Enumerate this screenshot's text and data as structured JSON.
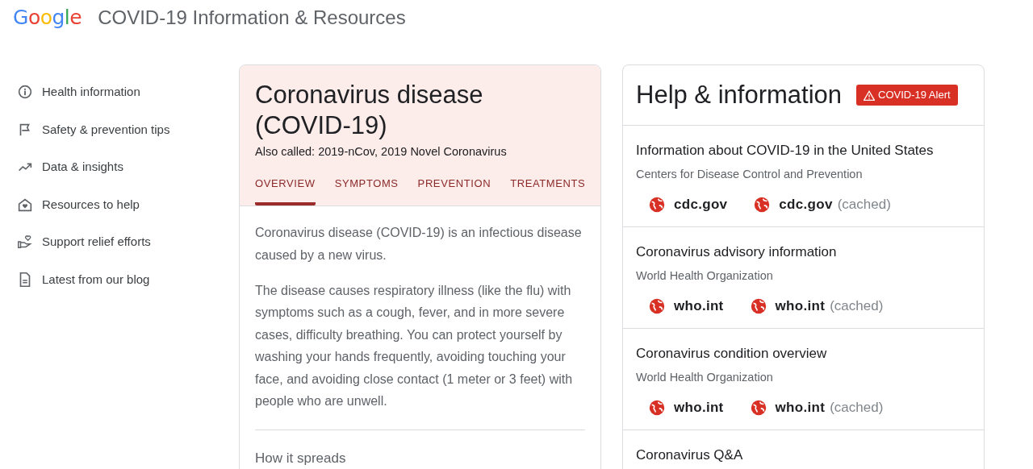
{
  "header": {
    "logo": "Google",
    "title": "COVID-19 Information & Resources"
  },
  "sidebar": {
    "items": [
      {
        "label": "Health information"
      },
      {
        "label": "Safety & prevention tips"
      },
      {
        "label": "Data & insights"
      },
      {
        "label": "Resources to help"
      },
      {
        "label": "Support relief efforts"
      },
      {
        "label": "Latest from our blog"
      }
    ]
  },
  "disease_card": {
    "title": "Coronavirus disease (COVID-19)",
    "also_called": "Also called: 2019-nCov, 2019 Novel Coronavirus",
    "tabs": [
      {
        "label": "OVERVIEW",
        "selected": true
      },
      {
        "label": "SYMPTOMS",
        "selected": false
      },
      {
        "label": "PREVENTION",
        "selected": false
      },
      {
        "label": "TREATMENTS",
        "selected": false
      }
    ],
    "paragraphs": [
      "Coronavirus disease (COVID-19) is an infectious disease caused by a new virus.",
      "The disease causes respiratory illness (like the flu) with symptoms such as a cough, fever, and in more severe cases, difficulty breathing. You can protect yourself by washing your hands frequently, avoiding touching your face, and avoiding close contact (1 meter or 3 feet) with people who are unwell."
    ],
    "section_heading": "How it spreads"
  },
  "help_card": {
    "title": "Help & information",
    "alert": "COVID-19 Alert",
    "sections": [
      {
        "title": "Information about COVID-19 in the United States",
        "source": "Centers for Disease Control and Prevention",
        "links": [
          {
            "domain": "cdc.gov"
          },
          {
            "domain": "cdc.gov",
            "note": "(cached)"
          }
        ]
      },
      {
        "title": "Coronavirus advisory information",
        "source": "World Health Organization",
        "links": [
          {
            "domain": "who.int"
          },
          {
            "domain": "who.int",
            "note": "(cached)"
          }
        ]
      },
      {
        "title": "Coronavirus condition overview",
        "source": "World Health Organization",
        "links": [
          {
            "domain": "who.int"
          },
          {
            "domain": "who.int",
            "note": "(cached)"
          }
        ]
      },
      {
        "title": "Coronavirus Q&A"
      }
    ]
  }
}
